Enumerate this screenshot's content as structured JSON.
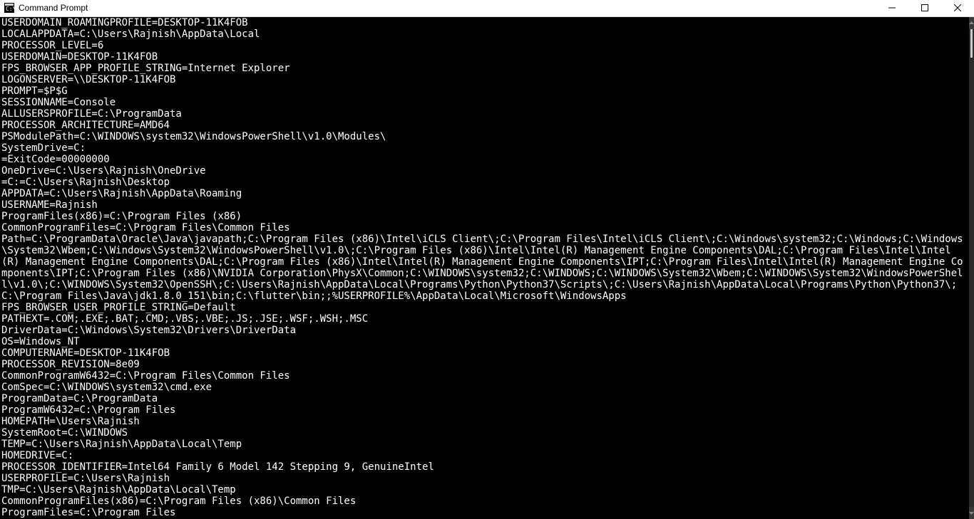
{
  "window": {
    "title": "Command Prompt"
  },
  "console": {
    "lines": [
      "USERDOMAIN_ROAMINGPROFILE=DESKTOP-11K4FOB",
      "LOCALAPPDATA=C:\\Users\\Rajnish\\AppData\\Local",
      "PROCESSOR_LEVEL=6",
      "USERDOMAIN=DESKTOP-11K4FOB",
      "FPS_BROWSER_APP_PROFILE_STRING=Internet Explorer",
      "LOGONSERVER=\\\\DESKTOP-11K4FOB",
      "PROMPT=$P$G",
      "SESSIONNAME=Console",
      "ALLUSERSPROFILE=C:\\ProgramData",
      "PROCESSOR_ARCHITECTURE=AMD64",
      "PSModulePath=C:\\WINDOWS\\system32\\WindowsPowerShell\\v1.0\\Modules\\",
      "SystemDrive=C:",
      "=ExitCode=00000000",
      "OneDrive=C:\\Users\\Rajnish\\OneDrive",
      "=C:=C:\\Users\\Rajnish\\Desktop",
      "APPDATA=C:\\Users\\Rajnish\\AppData\\Roaming",
      "USERNAME=Rajnish",
      "ProgramFiles(x86)=C:\\Program Files (x86)",
      "CommonProgramFiles=C:\\Program Files\\Common Files",
      "Path=C:\\ProgramData\\Oracle\\Java\\javapath;C:\\Program Files (x86)\\Intel\\iCLS Client\\;C:\\Program Files\\Intel\\iCLS Client\\;C:\\Windows\\system32;C:\\Windows;C:\\Windows\\System32\\Wbem;C:\\Windows\\System32\\WindowsPowerShell\\v1.0\\;C:\\Program Files (x86)\\Intel\\Intel(R) Management Engine Components\\DAL;C:\\Program Files\\Intel\\Intel(R) Management Engine Components\\DAL;C:\\Program Files (x86)\\Intel\\Intel(R) Management Engine Components\\IPT;C:\\Program Files\\Intel\\Intel(R) Management Engine Components\\IPT;C:\\Program Files (x86)\\NVIDIA Corporation\\PhysX\\Common;C:\\WINDOWS\\system32;C:\\WINDOWS;C:\\WINDOWS\\System32\\Wbem;C:\\WINDOWS\\System32\\WindowsPowerShell\\v1.0\\;C:\\WINDOWS\\System32\\OpenSSH\\;C:\\Users\\Rajnish\\AppData\\Local\\Programs\\Python\\Python37\\Scripts\\;C:\\Users\\Rajnish\\AppData\\Local\\Programs\\Python\\Python37\\;C:\\Program Files\\Java\\jdk1.8.0_151\\bin;C:\\flutter\\bin;;%USERPROFILE%\\AppData\\Local\\Microsoft\\WindowsApps",
      "FPS_BROWSER_USER_PROFILE_STRING=Default",
      "PATHEXT=.COM;.EXE;.BAT;.CMD;.VBS;.VBE;.JS;.JSE;.WSF;.WSH;.MSC",
      "DriverData=C:\\Windows\\System32\\Drivers\\DriverData",
      "OS=Windows_NT",
      "COMPUTERNAME=DESKTOP-11K4FOB",
      "PROCESSOR_REVISION=8e09",
      "CommonProgramW6432=C:\\Program Files\\Common Files",
      "ComSpec=C:\\WINDOWS\\system32\\cmd.exe",
      "ProgramData=C:\\ProgramData",
      "ProgramW6432=C:\\Program Files",
      "HOMEPATH=\\Users\\Rajnish",
      "SystemRoot=C:\\WINDOWS",
      "TEMP=C:\\Users\\Rajnish\\AppData\\Local\\Temp",
      "HOMEDRIVE=C:",
      "PROCESSOR_IDENTIFIER=Intel64 Family 6 Model 142 Stepping 9, GenuineIntel",
      "USERPROFILE=C:\\Users\\Rajnish",
      "TMP=C:\\Users\\Rajnish\\AppData\\Local\\Temp",
      "CommonProgramFiles(x86)=C:\\Program Files (x86)\\Common Files",
      "ProgramFiles=C:\\Program Files"
    ]
  }
}
